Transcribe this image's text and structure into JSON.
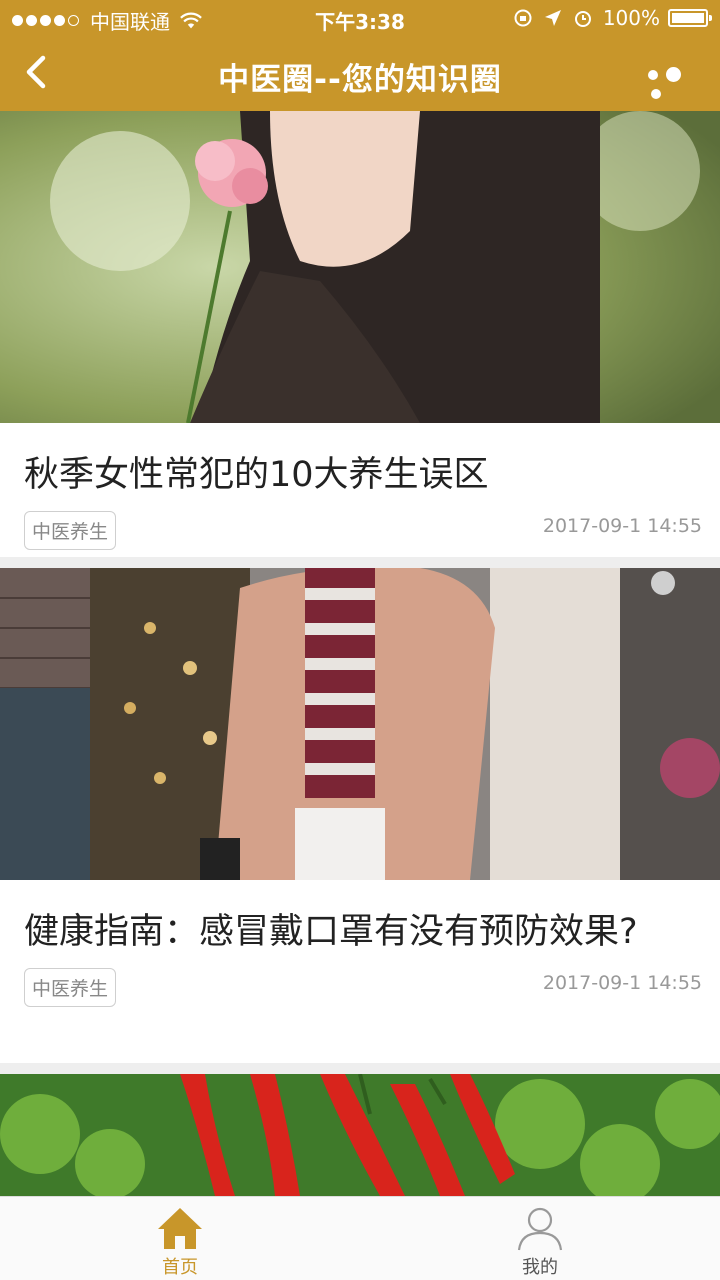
{
  "status_bar": {
    "carrier": "中国联通",
    "time": "下午3:38",
    "battery": "100%"
  },
  "nav": {
    "title": "中医圈--您的知识圈",
    "back_icon": "chevron-left-icon",
    "more_icon": "more-dots-icon"
  },
  "articles": [
    {
      "title": "秋季女性常犯的10大养生误区",
      "tag": "中医养生",
      "date": "2017-09-1 14:55"
    },
    {
      "title": "健康指南：感冒戴口罩有没有预防效果?",
      "tag": "中医养生",
      "date": "2017-09-1 14:55"
    }
  ],
  "tabs": [
    {
      "label": "首页",
      "icon": "home-icon",
      "active": true
    },
    {
      "label": "我的",
      "icon": "user-icon",
      "active": false
    }
  ],
  "colors": {
    "accent": "#c8962a",
    "background": "#eeeeee"
  }
}
